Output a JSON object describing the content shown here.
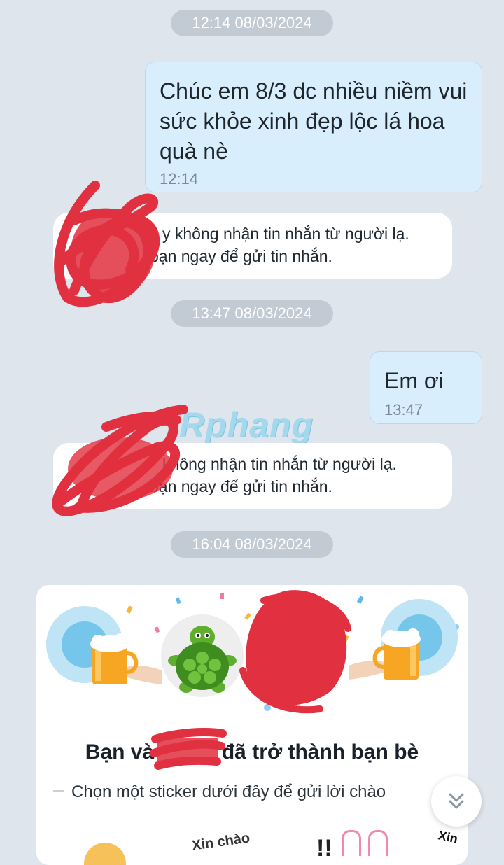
{
  "timestamps": [
    "12:14 08/03/2024",
    "13:47 08/03/2024",
    "16:04 08/03/2024"
  ],
  "messages": [
    {
      "text": "Chúc em 8/3 dc nhiều niềm vui sức khỏe xinh đẹp lộc lá hoa quà nè",
      "time": "12:14"
    },
    {
      "text": "Em ơi",
      "time": "13:47"
    }
  ],
  "notices": [
    {
      "line1": "y không nhận tin nhắn từ người lạ.",
      "line2": "bạn ngay để gửi tin nhắn."
    },
    {
      "line1": "không nhận tin nhắn từ người lạ.",
      "line2": "bạn ngay để gửi tin nhắn."
    }
  ],
  "watermark": "Rphang",
  "friend_card": {
    "title_prefix": "Bạn và",
    "title_suffix": "đã trở thành bạn bè",
    "subtitle": "Chọn một sticker dưới đây để gửi lời chào",
    "stickers": [
      {
        "label": ""
      },
      {
        "label": "Xin chào"
      },
      {
        "label": "!!"
      },
      {
        "label": "Xin"
      }
    ]
  },
  "icons": {
    "scroll_down": "double-chevron-down-icon",
    "beer_mug": "beer-mug-icon",
    "turtle": "turtle-avatar-icon"
  },
  "colors": {
    "background": "#dfe5ec",
    "outgoing_bubble": "#d9eefc",
    "redaction": "#e1303f"
  }
}
